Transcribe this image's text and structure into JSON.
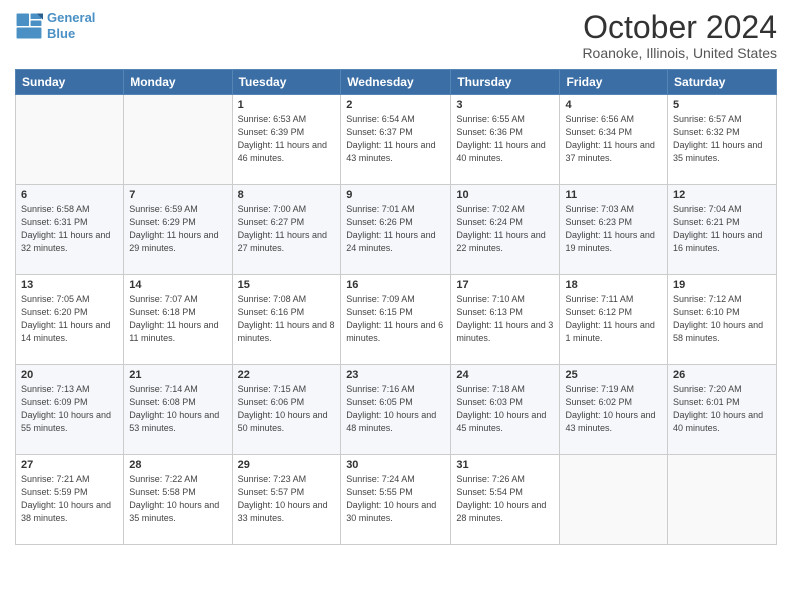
{
  "header": {
    "logo_line1": "General",
    "logo_line2": "Blue",
    "month_title": "October 2024",
    "location": "Roanoke, Illinois, United States"
  },
  "weekdays": [
    "Sunday",
    "Monday",
    "Tuesday",
    "Wednesday",
    "Thursday",
    "Friday",
    "Saturday"
  ],
  "weeks": [
    [
      {
        "day": "",
        "info": ""
      },
      {
        "day": "",
        "info": ""
      },
      {
        "day": "1",
        "info": "Sunrise: 6:53 AM\nSunset: 6:39 PM\nDaylight: 11 hours and 46 minutes."
      },
      {
        "day": "2",
        "info": "Sunrise: 6:54 AM\nSunset: 6:37 PM\nDaylight: 11 hours and 43 minutes."
      },
      {
        "day": "3",
        "info": "Sunrise: 6:55 AM\nSunset: 6:36 PM\nDaylight: 11 hours and 40 minutes."
      },
      {
        "day": "4",
        "info": "Sunrise: 6:56 AM\nSunset: 6:34 PM\nDaylight: 11 hours and 37 minutes."
      },
      {
        "day": "5",
        "info": "Sunrise: 6:57 AM\nSunset: 6:32 PM\nDaylight: 11 hours and 35 minutes."
      }
    ],
    [
      {
        "day": "6",
        "info": "Sunrise: 6:58 AM\nSunset: 6:31 PM\nDaylight: 11 hours and 32 minutes."
      },
      {
        "day": "7",
        "info": "Sunrise: 6:59 AM\nSunset: 6:29 PM\nDaylight: 11 hours and 29 minutes."
      },
      {
        "day": "8",
        "info": "Sunrise: 7:00 AM\nSunset: 6:27 PM\nDaylight: 11 hours and 27 minutes."
      },
      {
        "day": "9",
        "info": "Sunrise: 7:01 AM\nSunset: 6:26 PM\nDaylight: 11 hours and 24 minutes."
      },
      {
        "day": "10",
        "info": "Sunrise: 7:02 AM\nSunset: 6:24 PM\nDaylight: 11 hours and 22 minutes."
      },
      {
        "day": "11",
        "info": "Sunrise: 7:03 AM\nSunset: 6:23 PM\nDaylight: 11 hours and 19 minutes."
      },
      {
        "day": "12",
        "info": "Sunrise: 7:04 AM\nSunset: 6:21 PM\nDaylight: 11 hours and 16 minutes."
      }
    ],
    [
      {
        "day": "13",
        "info": "Sunrise: 7:05 AM\nSunset: 6:20 PM\nDaylight: 11 hours and 14 minutes."
      },
      {
        "day": "14",
        "info": "Sunrise: 7:07 AM\nSunset: 6:18 PM\nDaylight: 11 hours and 11 minutes."
      },
      {
        "day": "15",
        "info": "Sunrise: 7:08 AM\nSunset: 6:16 PM\nDaylight: 11 hours and 8 minutes."
      },
      {
        "day": "16",
        "info": "Sunrise: 7:09 AM\nSunset: 6:15 PM\nDaylight: 11 hours and 6 minutes."
      },
      {
        "day": "17",
        "info": "Sunrise: 7:10 AM\nSunset: 6:13 PM\nDaylight: 11 hours and 3 minutes."
      },
      {
        "day": "18",
        "info": "Sunrise: 7:11 AM\nSunset: 6:12 PM\nDaylight: 11 hours and 1 minute."
      },
      {
        "day": "19",
        "info": "Sunrise: 7:12 AM\nSunset: 6:10 PM\nDaylight: 10 hours and 58 minutes."
      }
    ],
    [
      {
        "day": "20",
        "info": "Sunrise: 7:13 AM\nSunset: 6:09 PM\nDaylight: 10 hours and 55 minutes."
      },
      {
        "day": "21",
        "info": "Sunrise: 7:14 AM\nSunset: 6:08 PM\nDaylight: 10 hours and 53 minutes."
      },
      {
        "day": "22",
        "info": "Sunrise: 7:15 AM\nSunset: 6:06 PM\nDaylight: 10 hours and 50 minutes."
      },
      {
        "day": "23",
        "info": "Sunrise: 7:16 AM\nSunset: 6:05 PM\nDaylight: 10 hours and 48 minutes."
      },
      {
        "day": "24",
        "info": "Sunrise: 7:18 AM\nSunset: 6:03 PM\nDaylight: 10 hours and 45 minutes."
      },
      {
        "day": "25",
        "info": "Sunrise: 7:19 AM\nSunset: 6:02 PM\nDaylight: 10 hours and 43 minutes."
      },
      {
        "day": "26",
        "info": "Sunrise: 7:20 AM\nSunset: 6:01 PM\nDaylight: 10 hours and 40 minutes."
      }
    ],
    [
      {
        "day": "27",
        "info": "Sunrise: 7:21 AM\nSunset: 5:59 PM\nDaylight: 10 hours and 38 minutes."
      },
      {
        "day": "28",
        "info": "Sunrise: 7:22 AM\nSunset: 5:58 PM\nDaylight: 10 hours and 35 minutes."
      },
      {
        "day": "29",
        "info": "Sunrise: 7:23 AM\nSunset: 5:57 PM\nDaylight: 10 hours and 33 minutes."
      },
      {
        "day": "30",
        "info": "Sunrise: 7:24 AM\nSunset: 5:55 PM\nDaylight: 10 hours and 30 minutes."
      },
      {
        "day": "31",
        "info": "Sunrise: 7:26 AM\nSunset: 5:54 PM\nDaylight: 10 hours and 28 minutes."
      },
      {
        "day": "",
        "info": ""
      },
      {
        "day": "",
        "info": ""
      }
    ]
  ]
}
